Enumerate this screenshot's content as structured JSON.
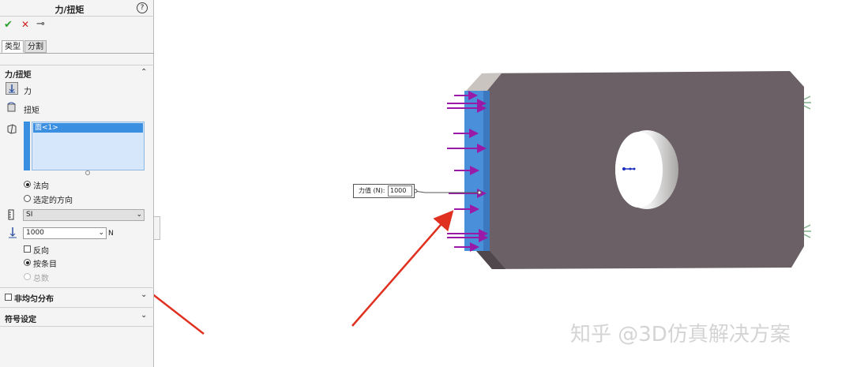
{
  "panel": {
    "title": "力/扭矩",
    "help_label": "?",
    "confirm_glyph": "✔",
    "cancel_glyph": "✕",
    "pin_glyph": "⊸",
    "tabs": [
      {
        "label": "类型"
      },
      {
        "label": "分割"
      }
    ],
    "section_force": {
      "header": "力/扭矩",
      "force_label": "力",
      "torque_label": "扭矩",
      "selection_item": "面<1>",
      "direction_normal": "法向",
      "direction_selected": "选定的方向",
      "unit_system": "SI",
      "force_value": "1000",
      "force_unit": "N",
      "reverse_label": "反向",
      "per_item_label": "按条目",
      "total_label": "总数"
    },
    "nonuniform_label": "非均匀分布",
    "symbol_label": "符号设定"
  },
  "viewport": {
    "callout_label": "力值 (N):",
    "callout_value": "1000"
  },
  "watermark": "知乎 @3D仿真解决方案",
  "colors": {
    "selected_face": "#4a8fd9",
    "block": "#6a6065",
    "arrow": "#9a1aa8",
    "annotation_arrow": "#e03020",
    "accent_check": "#2ea02e",
    "accent_cancel": "#d02020"
  }
}
